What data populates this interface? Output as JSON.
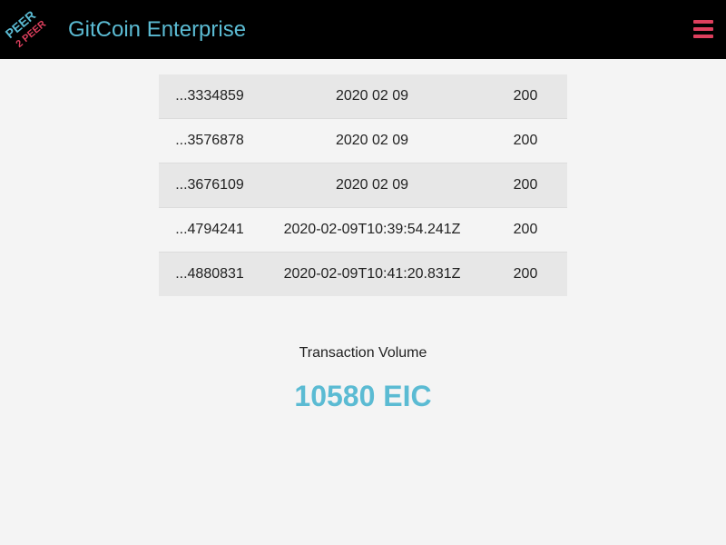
{
  "header": {
    "logo_text_top": "PEER",
    "logo_text_bottom": "2 PEER",
    "brand_title": "GitCoin Enterprise",
    "menu_icon": "hamburger-menu-icon",
    "colors": {
      "background": "#000000",
      "brand": "#5bbbd3",
      "menu": "#dd3f5d"
    }
  },
  "transactions": [
    {
      "id": "...3334859",
      "date": "2020 02 09",
      "amount": "200"
    },
    {
      "id": "...3576878",
      "date": "2020 02 09",
      "amount": "200"
    },
    {
      "id": "...3676109",
      "date": "2020 02 09",
      "amount": "200"
    },
    {
      "id": "...4794241",
      "date": "2020-02-09T10:39:54.241Z",
      "amount": "200"
    },
    {
      "id": "...4880831",
      "date": "2020-02-09T10:41:20.831Z",
      "amount": "200"
    }
  ],
  "summary": {
    "label": "Transaction Volume",
    "value": "10580 EIC"
  }
}
